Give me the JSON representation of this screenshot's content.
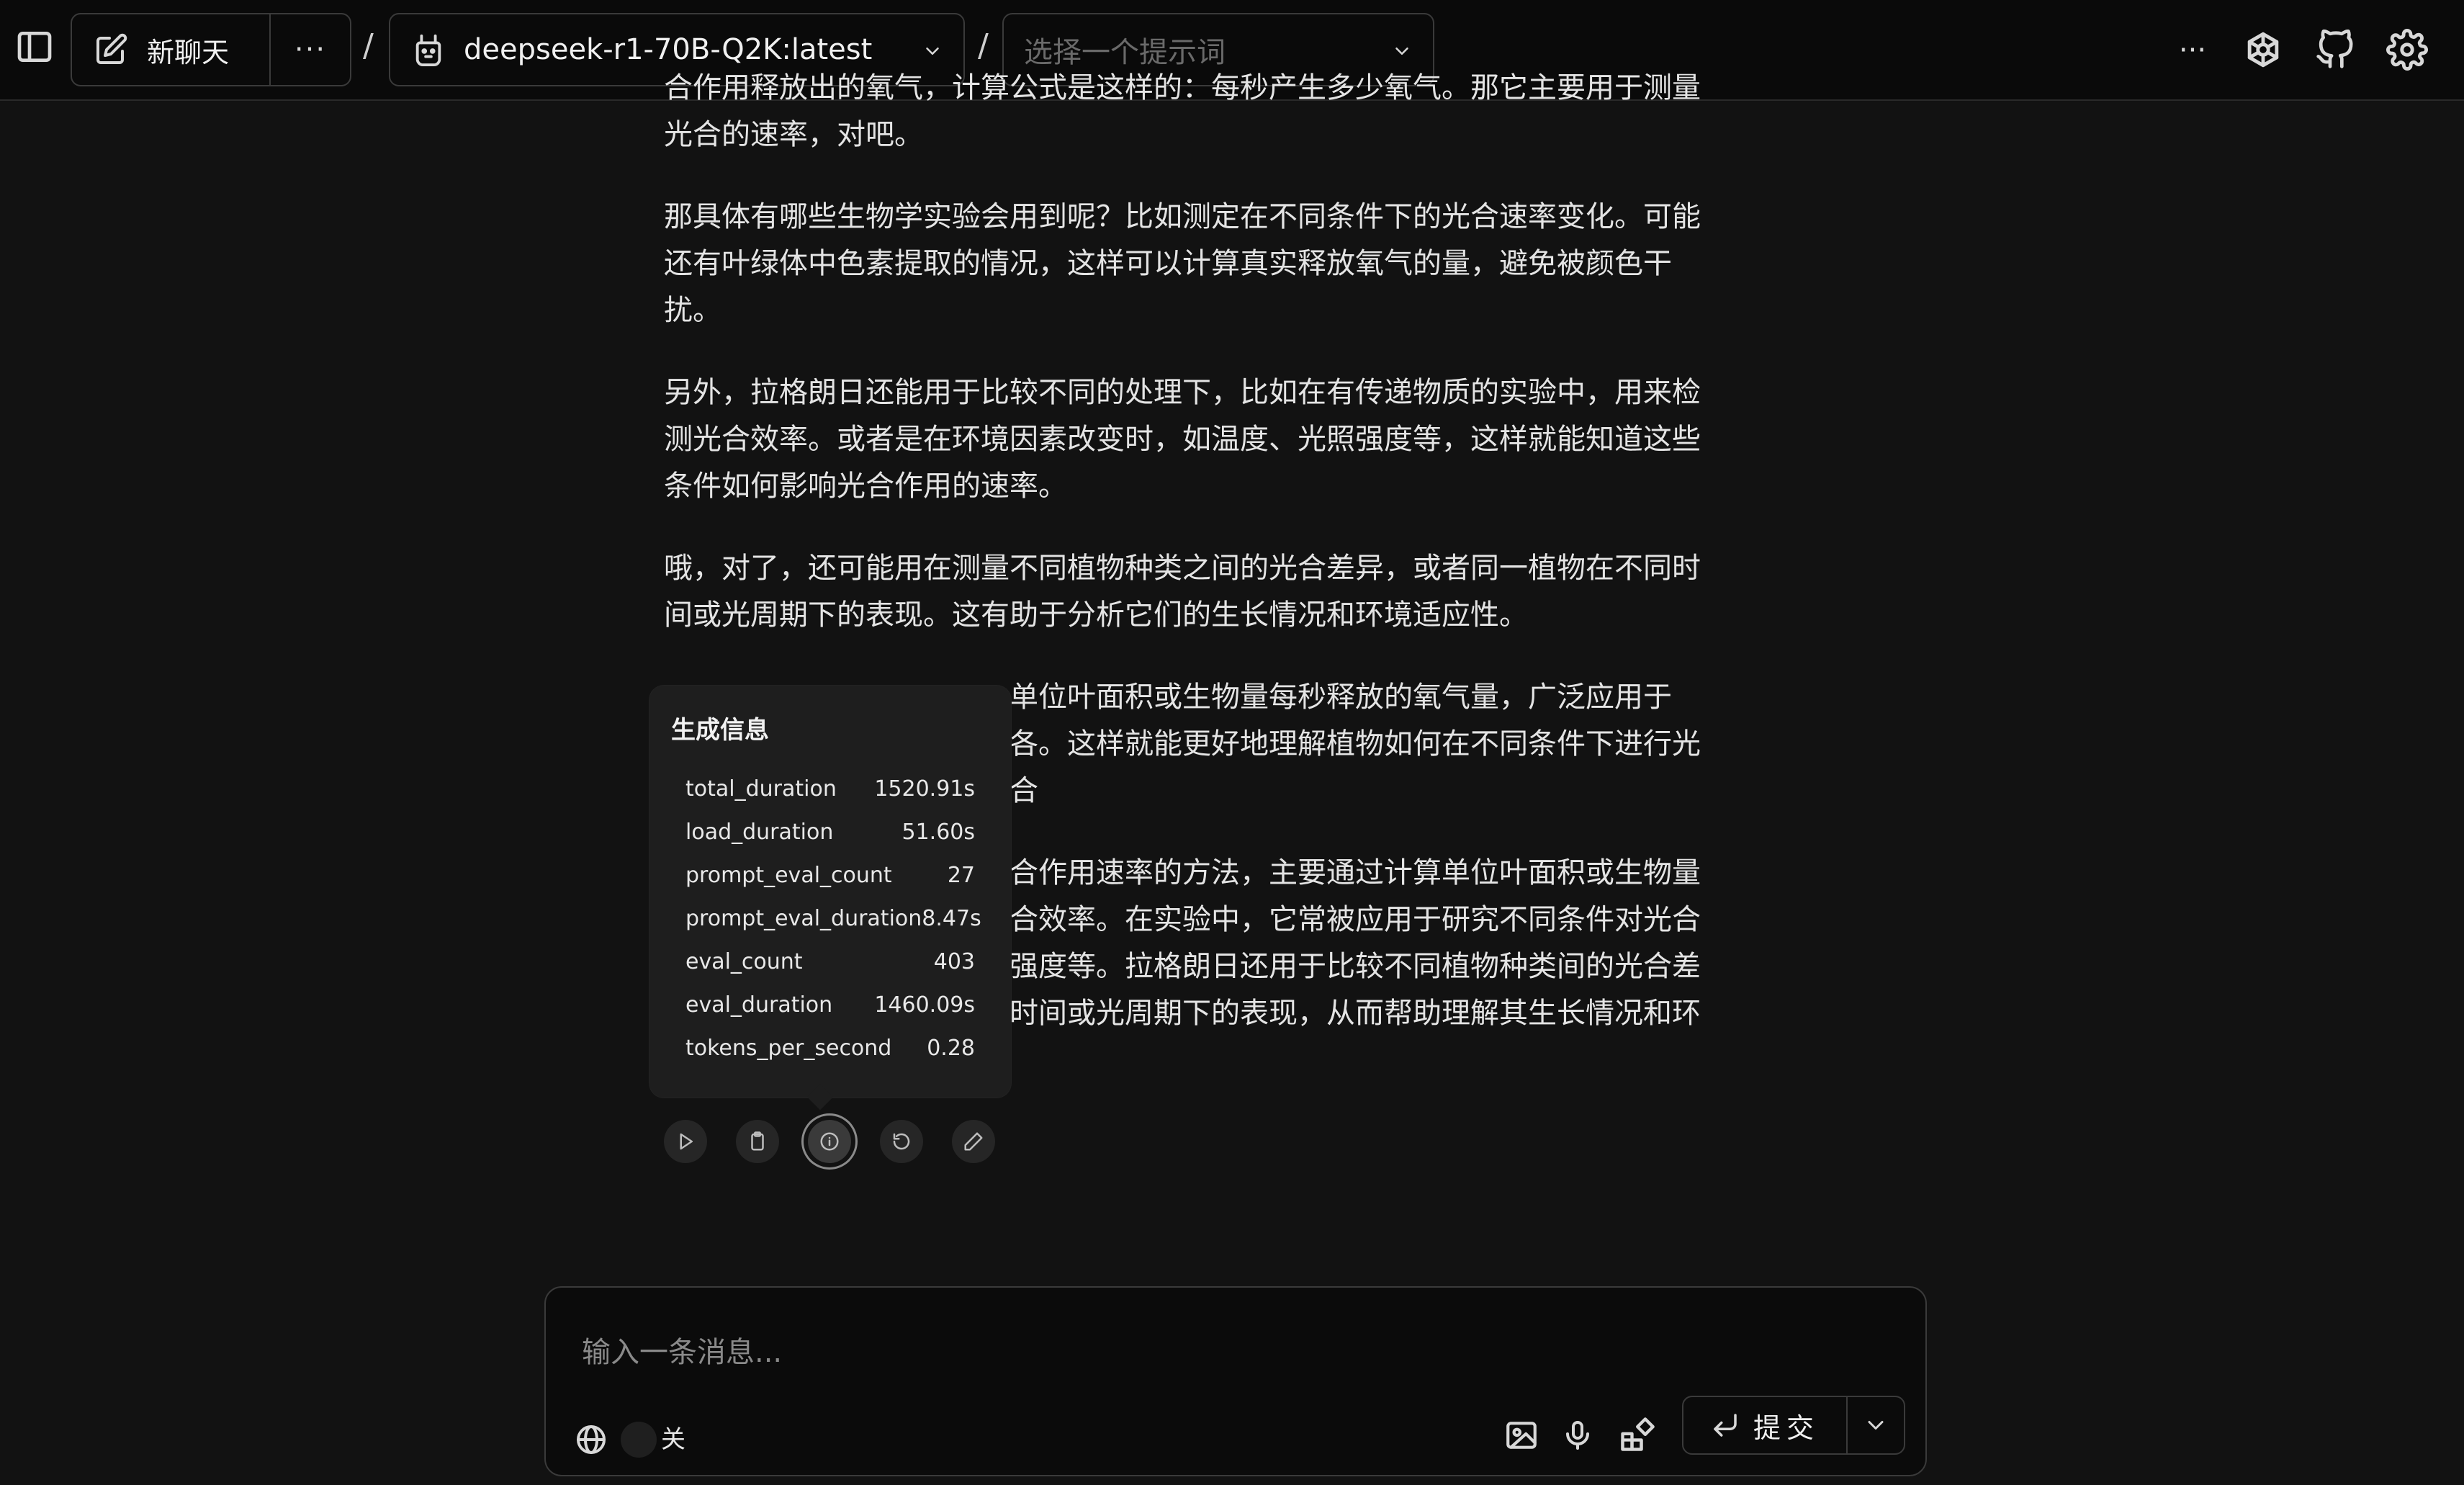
{
  "header": {
    "new_chat_label": "新聊天",
    "more_label": "···",
    "separator": "/",
    "model": "deepseek-r1-70B-Q2K:latest",
    "prompt_placeholder": "选择一个提示词",
    "right_more_label": "···"
  },
  "messages": {
    "paragraphs": [
      "合作用释放出的氧气，计算公式是这样的：每秒产生多少氧气。那它主要用于测量光合的速率，对吧。",
      "那具体有哪些生物学实验会用到呢？比如测定在不同条件下的光合速率变化。可能还有叶绿体中色素提取的情况，这样可以计算真实释放氧气的量，避免被颜色干扰。",
      "另外，拉格朗日还能用于比较不同的处理下，比如在有传递物质的实验中，用来检测光合效率。或者是在环境因素改变时，如温度、光照强度等，这样就能知道这些条件如何影响光合作用的速率。",
      "哦，对了，还可能用在测量不同植物种类之间的光合差异，或者同一植物在不同时间或光周期下的表现。这有助于分析它们的生长情况和环境适应性。",
      "单位叶面积或生物量每秒释放的氧气量，广泛应用于各。这样就能更好地理解植物如何在不同条件下进行光合",
      "合作用速率的方法，主要通过计算单位叶面积或生物量合效率。在实验中，它常被应用于研究不同条件对光合强度等。拉格朗日还用于比较不同植物种类间的光合差时间或光周期下的表现，从而帮助理解其生长情况和环"
    ]
  },
  "generation_info": {
    "title": "生成信息",
    "rows": [
      {
        "key": "total_duration",
        "value": "1520.91s"
      },
      {
        "key": "load_duration",
        "value": "51.60s"
      },
      {
        "key": "prompt_eval_count",
        "value": "27"
      },
      {
        "key": "prompt_eval_duration",
        "value": "8.47s"
      },
      {
        "key": "eval_count",
        "value": "403"
      },
      {
        "key": "eval_duration",
        "value": "1460.09s"
      },
      {
        "key": "tokens_per_second",
        "value": "0.28"
      }
    ]
  },
  "composer": {
    "placeholder": "输入一条消息...",
    "toggle_label": "关",
    "submit_label": "提交"
  },
  "icons": {
    "sidebar": "sidebar-toggle-icon",
    "edit": "edit-icon",
    "model": "llama-icon",
    "openai": "openai-icon",
    "github": "github-icon",
    "settings": "gear-icon"
  }
}
